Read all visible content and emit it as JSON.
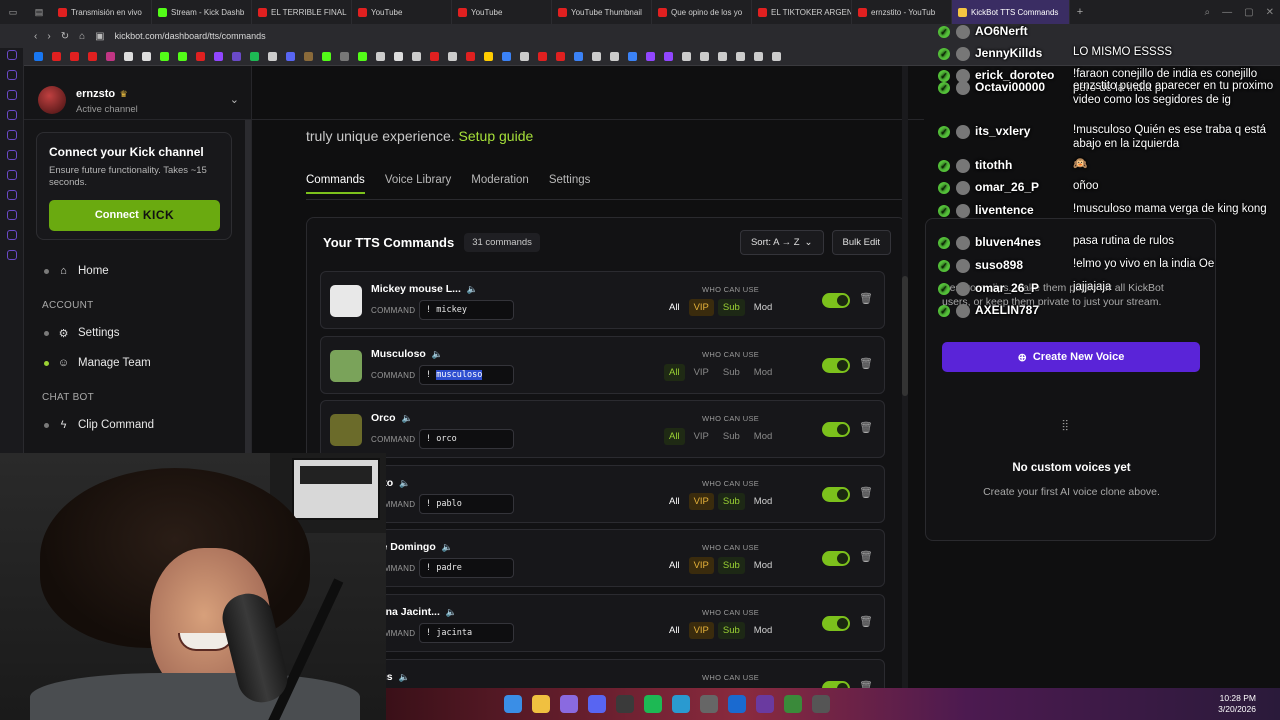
{
  "browser": {
    "tabs": [
      {
        "label": "Transmisión en vivo",
        "color": "#e02020"
      },
      {
        "label": "Stream - Kick Dashb",
        "color": "#53fc18"
      },
      {
        "label": "EL TERRIBLE FINAL",
        "color": "#e02020"
      },
      {
        "label": "YouTube",
        "color": "#e02020"
      },
      {
        "label": "YouTube",
        "color": "#e02020"
      },
      {
        "label": "YouTube Thumbnail",
        "color": "#e02020"
      },
      {
        "label": "Que opino de los yo",
        "color": "#e02020"
      },
      {
        "label": "EL TIKTOKER ARGEN",
        "color": "#e02020"
      },
      {
        "label": "ernzstito - YouTub",
        "color": "#e02020"
      }
    ],
    "active_tab": "KickBot TTS Commands",
    "url": "kickbot.com/dashboard/tts/commands",
    "ai_label": "AI"
  },
  "sidebar": {
    "channel_name": "ernzsto",
    "channel_status": "Active channel",
    "connect": {
      "title": "Connect your Kick channel",
      "desc": "Ensure future functionality. Takes ~15 seconds.",
      "button_label": "Connect",
      "button_brand": "KICK"
    },
    "home": "Home",
    "account_head": "ACCOUNT",
    "settings": "Settings",
    "manage_team": "Manage Team",
    "chatbot_head": "CHAT BOT",
    "clip_command": "Clip Command"
  },
  "main": {
    "intro_text": "truly unique experience.",
    "setup_guide": "Setup guide",
    "tabs": [
      "Commands",
      "Voice Library",
      "Moderation",
      "Settings"
    ],
    "panel_title": "Your TTS Commands",
    "count": "31 commands",
    "sort_label": "Sort: A → Z",
    "bulk_edit": "Bulk Edit",
    "command_label": "COMMAND",
    "who_label": "WHO CAN USE",
    "perm_labels": [
      "All",
      "VIP",
      "Sub",
      "Mod"
    ],
    "commands": [
      {
        "name": "Mickey mouse L...",
        "cmd": "mickey",
        "thumb": "#e8e8e8",
        "perms": [
          "VIP",
          "Sub",
          "Mod"
        ]
      },
      {
        "name": "Musculoso",
        "cmd": "musculoso",
        "thumb": "#7aa35a",
        "perms": [
          "All"
        ]
      },
      {
        "name": "Orco",
        "cmd": "orco",
        "thumb": "#6b6b2a",
        "perms": [
          "All"
        ]
      },
      {
        "name": "blito",
        "cmd": "pablo",
        "thumb": "#555555",
        "perms": [
          "VIP",
          "Sub",
          "Mod"
        ]
      },
      {
        "name": "dre Domingo",
        "cmd": "padre",
        "thumb": "#555555",
        "perms": [
          "VIP",
          "Sub",
          "Mod"
        ]
      },
      {
        "name": "isana Jacint...",
        "cmd": "jacinta",
        "thumb": "#555555",
        "perms": [
          "VIP",
          "Sub",
          "Mod"
        ]
      },
      {
        "name": "bius",
        "cmd": "",
        "thumb": "#555555",
        "perms": []
      }
    ]
  },
  "voices": {
    "desc_visible": "ices from clips. Make them public for all KickBot users, or keep them private to just your stream.",
    "create_button": "Create New Voice",
    "empty_title": "No custom voices yet",
    "empty_sub": "Create your first AI voice clone above."
  },
  "chat": [
    {
      "user": "AO6Nerft",
      "msg": ""
    },
    {
      "user": "JennyKillds",
      "msg": "LO MISMO ESSSS"
    },
    {
      "user": "erick_doroteo",
      "msg": "!faraon conejillo de india es conejillo pero de la india p"
    },
    {
      "user": "Octavi00000",
      "msg": "ernzstito puedo aparecer en tu proximo video como los segidores de ig"
    },
    {
      "user": "its_vxlery",
      "msg": "!musculoso Quién es ese traba q está abajo en la izquierda"
    },
    {
      "user": "titothh",
      "msg": "🙉"
    },
    {
      "user": "omar_26_P",
      "msg": "oñoo"
    },
    {
      "user": "liventence",
      "msg": "!musculoso mama verga de king kong"
    },
    {
      "user": "bluven4nes",
      "msg": "pasa rutina de rulos"
    },
    {
      "user": "suso898",
      "msg": "!elmo yo vivo en la india Oe"
    },
    {
      "user": "omar_26_P",
      "msg": "jajjajaja"
    },
    {
      "user": "AXELIN787",
      "msg": ""
    }
  ],
  "clock": {
    "time": "10:28 PM",
    "date": "3/20/2026"
  }
}
